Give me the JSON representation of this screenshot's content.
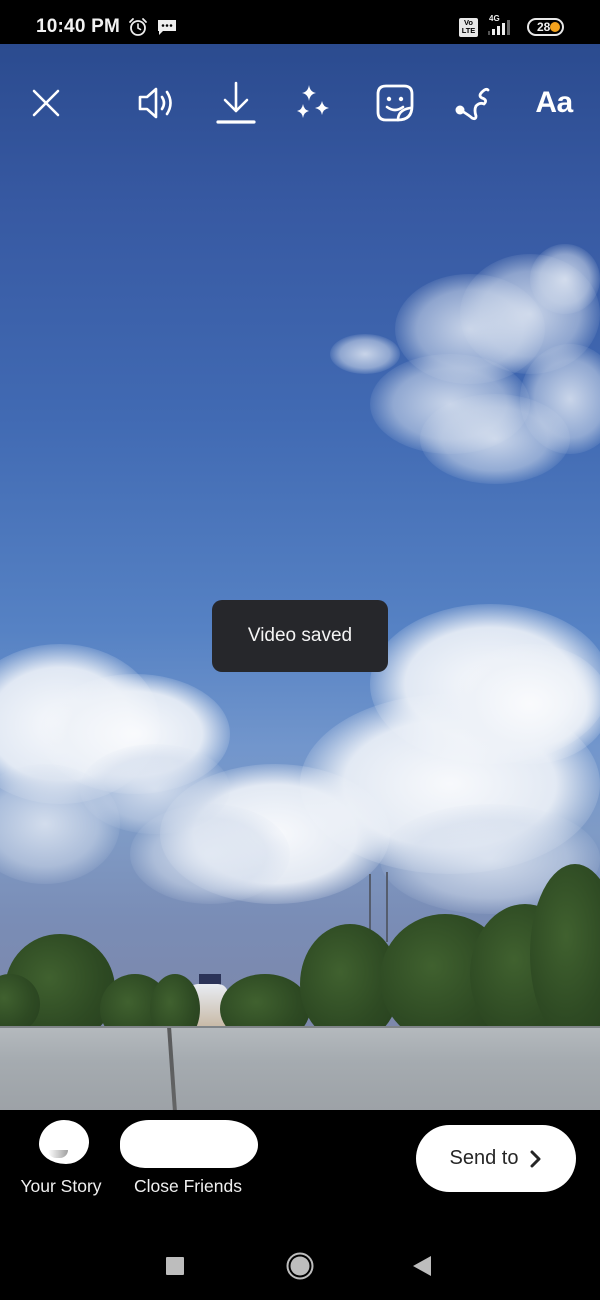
{
  "status_bar": {
    "time": "10:40 PM",
    "icons": [
      "alarm-icon",
      "message-notification-icon"
    ],
    "volte_label_top": "Vo",
    "volte_label_bottom": "LTE",
    "network_type": "4G",
    "battery_level": "28",
    "battery_saver_color": "#f3a21d"
  },
  "toolbar": {
    "close": {
      "icon": "close-icon"
    },
    "sound": {
      "icon": "speaker-volume-icon"
    },
    "download": {
      "icon": "download-icon"
    },
    "effects": {
      "icon": "sparkles-effects-icon"
    },
    "sticker": {
      "icon": "sticker-smiley-icon"
    },
    "draw": {
      "icon": "draw-squiggle-icon"
    },
    "text": {
      "icon": "text-tool-icon",
      "label": "Aa"
    }
  },
  "media": {
    "description": "Blue sky with white clouds over trees and a grey wall",
    "sky_top_color": "#2b4b8f",
    "sky_bottom_color": "#7f9bc6"
  },
  "toast": {
    "message": "Video saved"
  },
  "share_bar": {
    "targets": [
      {
        "label": "Your Story",
        "avatar": "redacted"
      },
      {
        "label": "Close Friends",
        "avatar": "redacted"
      }
    ],
    "send_to": {
      "label": "Send to",
      "icon": "chevron-right-icon"
    }
  },
  "nav_bar": {
    "buttons": [
      "recents-square-icon",
      "home-circle-icon",
      "back-triangle-icon"
    ],
    "icon_color": "#bdbdbd"
  }
}
